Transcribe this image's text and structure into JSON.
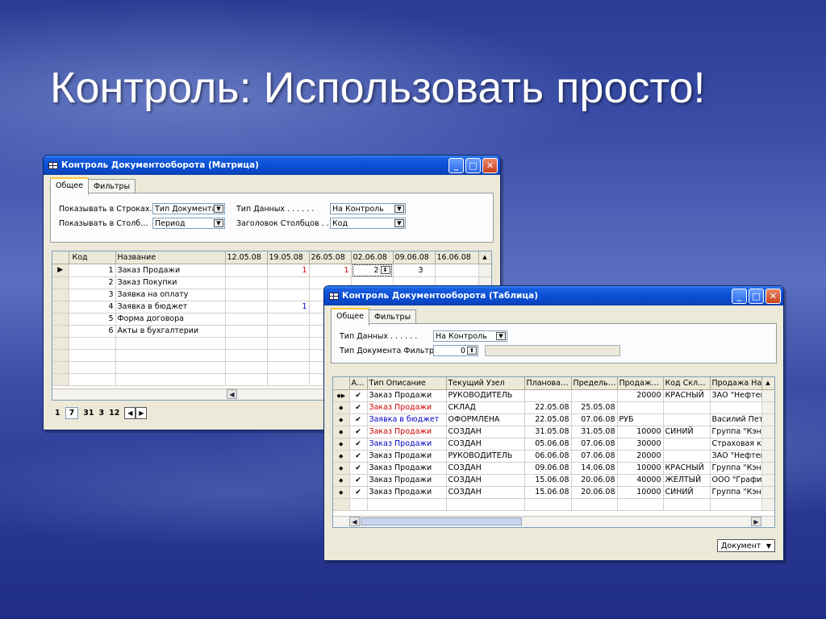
{
  "slide": {
    "title": "Контроль: Использовать просто!"
  },
  "matrix_window": {
    "title": "Контроль Документооборота (Матрица)",
    "tabs": [
      "Общее",
      "Фильтры"
    ],
    "fields": {
      "rows_label": "Показывать в Строках.",
      "rows_value": "Тип Документа",
      "cols_label": "Показывать в Столб…",
      "cols_value": "Период",
      "datatype_label": "Тип Данных . . . . . .",
      "datatype_value": "На Контроль",
      "colheader_label": "Заголовок Столбцов . .",
      "colheader_value": "Код"
    },
    "grid": {
      "headers": [
        "Код",
        "Название",
        "12.05.08",
        "19.05.08",
        "26.05.08",
        "02.06.08",
        "09.06.08",
        "16.06.08"
      ],
      "rows": [
        {
          "code": "1",
          "name": "Заказ Продажи",
          "c1": "",
          "c2": "1",
          "c3": "1",
          "c4": "2",
          "c5": "3",
          "c6": ""
        },
        {
          "code": "2",
          "name": "Заказ Покупки",
          "c1": "",
          "c2": "",
          "c3": "",
          "c4": "",
          "c5": "",
          "c6": ""
        },
        {
          "code": "3",
          "name": "Заявка на оплату",
          "c1": "",
          "c2": "",
          "c3": "",
          "c4": "",
          "c5": "",
          "c6": ""
        },
        {
          "code": "4",
          "name": "Заявка в бюджет",
          "c1": "",
          "c2": "1",
          "c3": "",
          "c4": "",
          "c5": "",
          "c6": ""
        },
        {
          "code": "5",
          "name": "Форма договора",
          "c1": "",
          "c2": "",
          "c3": "",
          "c4": "",
          "c5": "",
          "c6": ""
        },
        {
          "code": "6",
          "name": "Акты в бухгалтерии",
          "c1": "",
          "c2": "",
          "c3": "",
          "c4": "",
          "c5": "",
          "c6": ""
        }
      ]
    },
    "pager": {
      "p1": "1",
      "p2": "7",
      "p3": "31",
      "p4": "3",
      "p5": "12"
    }
  },
  "table_window": {
    "title": "Контроль Документооборота (Таблица)",
    "tabs": [
      "Общее",
      "Фильтры"
    ],
    "fields": {
      "datatype_label": "Тип Данных . . . . . .",
      "datatype_value": "На Контроль",
      "docfilter_label": "Тип Документа Фильтр.",
      "docfilter_value": "0"
    },
    "grid": {
      "headers": [
        "А…",
        "Тип Описание",
        "Текущий Узел",
        "Планова…",
        "Предель…",
        "Продаж…",
        "Код Скл…",
        "Продажа Наз"
      ],
      "rows": [
        {
          "type": "Заказ Продажи",
          "type_color": "black",
          "node": "РУКОВОДИТЕЛЬ",
          "plan": "",
          "limit": "",
          "sale": "20000",
          "code": "КРАСНЫЙ",
          "name": "ЗАО \"Нефтег"
        },
        {
          "type": "Заказ Продажи",
          "type_color": "red",
          "node": "СКЛАД",
          "plan": "22.05.08",
          "limit": "25.05.08",
          "sale": "",
          "code": "",
          "name": ""
        },
        {
          "type": "Заявка в бюджет",
          "type_color": "blue",
          "node": "ОФОРМЛЕНА",
          "plan": "22.05.08",
          "limit": "07.06.08",
          "sale": "РУБ",
          "code": "",
          "name": "Василий Петр"
        },
        {
          "type": "Заказ Продажи",
          "type_color": "red",
          "node": "СОЗДАН",
          "plan": "31.05.08",
          "limit": "31.05.08",
          "sale": "10000",
          "code": "СИНИЙ",
          "name": "Группа \"Кэнн"
        },
        {
          "type": "Заказ Продажи",
          "type_color": "blue",
          "node": "СОЗДАН",
          "plan": "05.06.08",
          "limit": "07.06.08",
          "sale": "30000",
          "code": "",
          "name": "Страховая к"
        },
        {
          "type": "Заказ Продажи",
          "type_color": "black",
          "node": "РУКОВОДИТЕЛЬ",
          "plan": "06.06.08",
          "limit": "07.06.08",
          "sale": "20000",
          "code": "",
          "name": "ЗАО \"Нефтег"
        },
        {
          "type": "Заказ Продажи",
          "type_color": "black",
          "node": "СОЗДАН",
          "plan": "09.06.08",
          "limit": "14.06.08",
          "sale": "10000",
          "code": "КРАСНЫЙ",
          "name": "Группа \"Кэнн"
        },
        {
          "type": "Заказ Продажи",
          "type_color": "black",
          "node": "СОЗДАН",
          "plan": "15.06.08",
          "limit": "20.06.08",
          "sale": "40000",
          "code": "ЖЕЛТЫЙ",
          "name": "ООО \"Графи"
        },
        {
          "type": "Заказ Продажи",
          "type_color": "black",
          "node": "СОЗДАН",
          "plan": "15.06.08",
          "limit": "20.06.08",
          "sale": "10000",
          "code": "СИНИЙ",
          "name": "Группа \"Кэнн"
        }
      ]
    },
    "document_button": "Документ"
  },
  "colors": {
    "titlebar": "#0a4fd6",
    "red_text": "#d00000",
    "blue_text": "#0000c8",
    "window_bg": "#ece9d8"
  }
}
